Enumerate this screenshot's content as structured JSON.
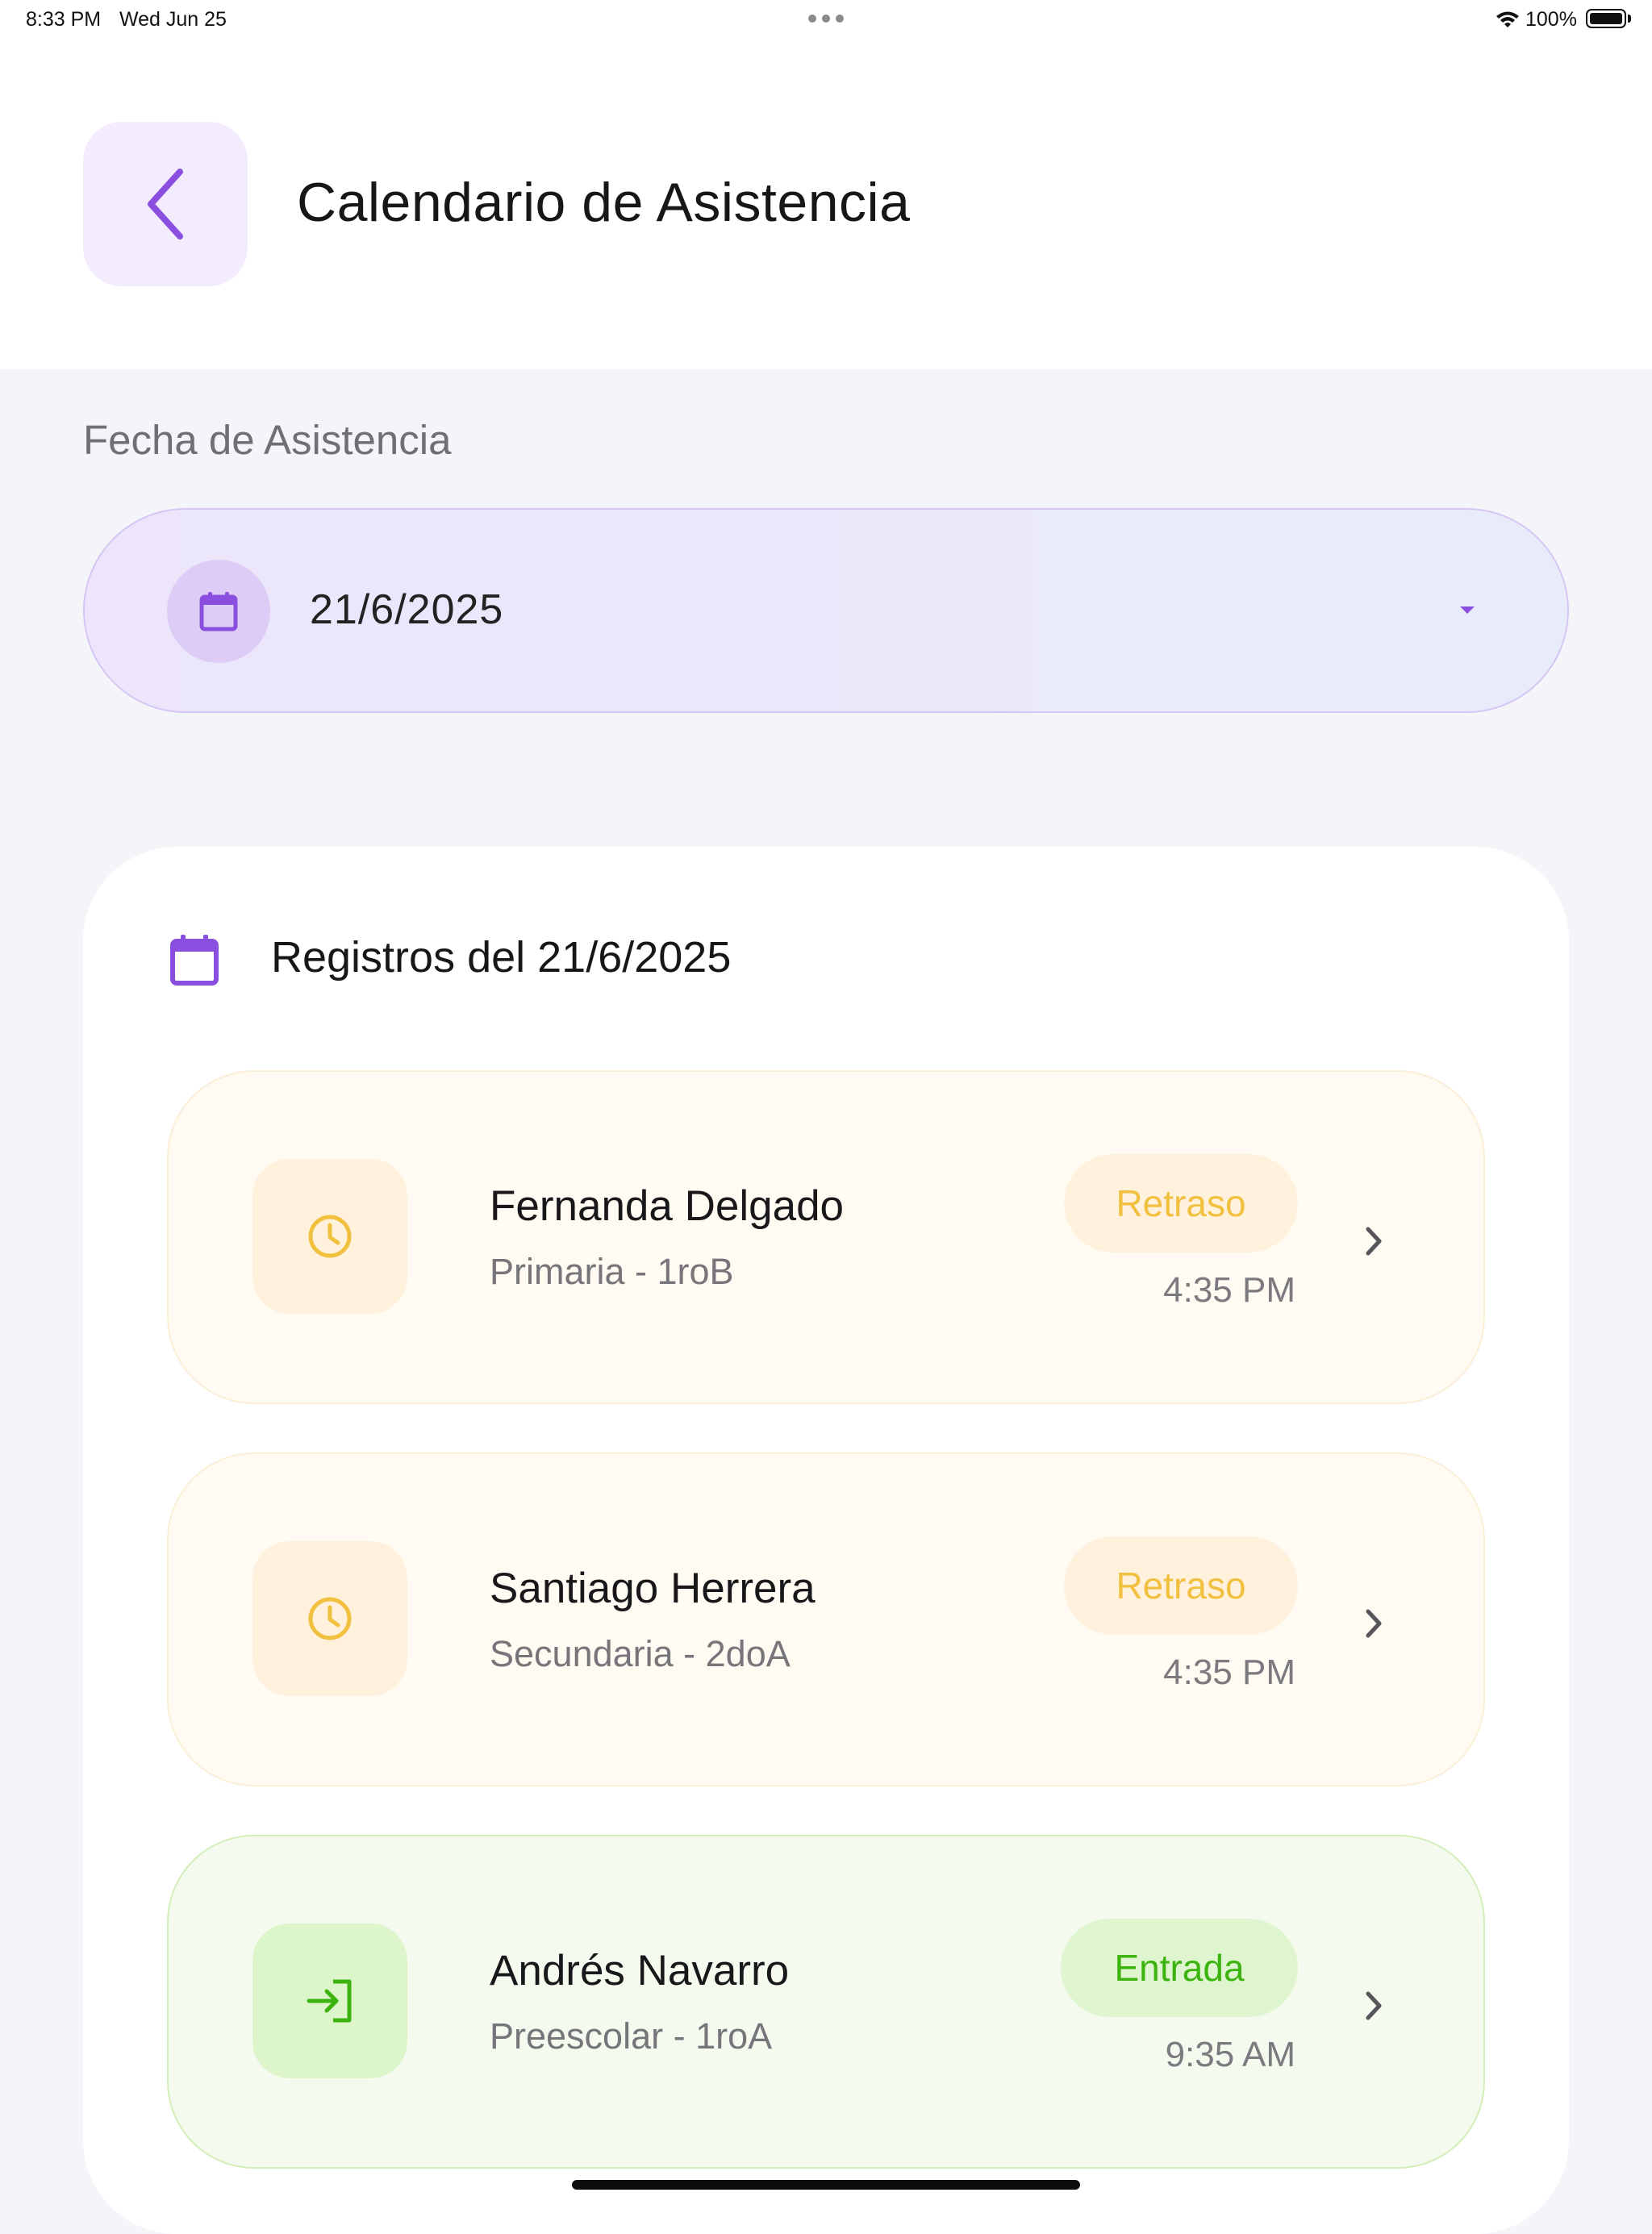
{
  "status_bar": {
    "time": "8:33 PM",
    "date": "Wed Jun 25",
    "battery": "100%"
  },
  "header": {
    "title": "Calendario de Asistencia",
    "back_icon": "chevron-left-icon"
  },
  "date_picker": {
    "label": "Fecha de Asistencia",
    "value": "21/6/2025",
    "icon": "calendar-icon",
    "dropdown_icon": "caret-down-icon"
  },
  "records": {
    "title": "Registros del 21/6/2025",
    "icon": "calendar-icon",
    "items": [
      {
        "name": "Fernanda Delgado",
        "group": "Primaria - 1roB",
        "status": "Retraso",
        "time": "4:35 PM",
        "icon": "clock-icon"
      },
      {
        "name": "Santiago Herrera",
        "group": "Secundaria - 2doA",
        "status": "Retraso",
        "time": "4:35 PM",
        "icon": "clock-icon"
      },
      {
        "name": "Andrés Navarro",
        "group": "Preescolar - 1roA",
        "status": "Entrada",
        "time": "9:35 AM",
        "icon": "login-icon"
      }
    ]
  },
  "colors": {
    "accent": "#8b4fe0",
    "late": "#f1c03f",
    "entry": "#3cb30f"
  }
}
